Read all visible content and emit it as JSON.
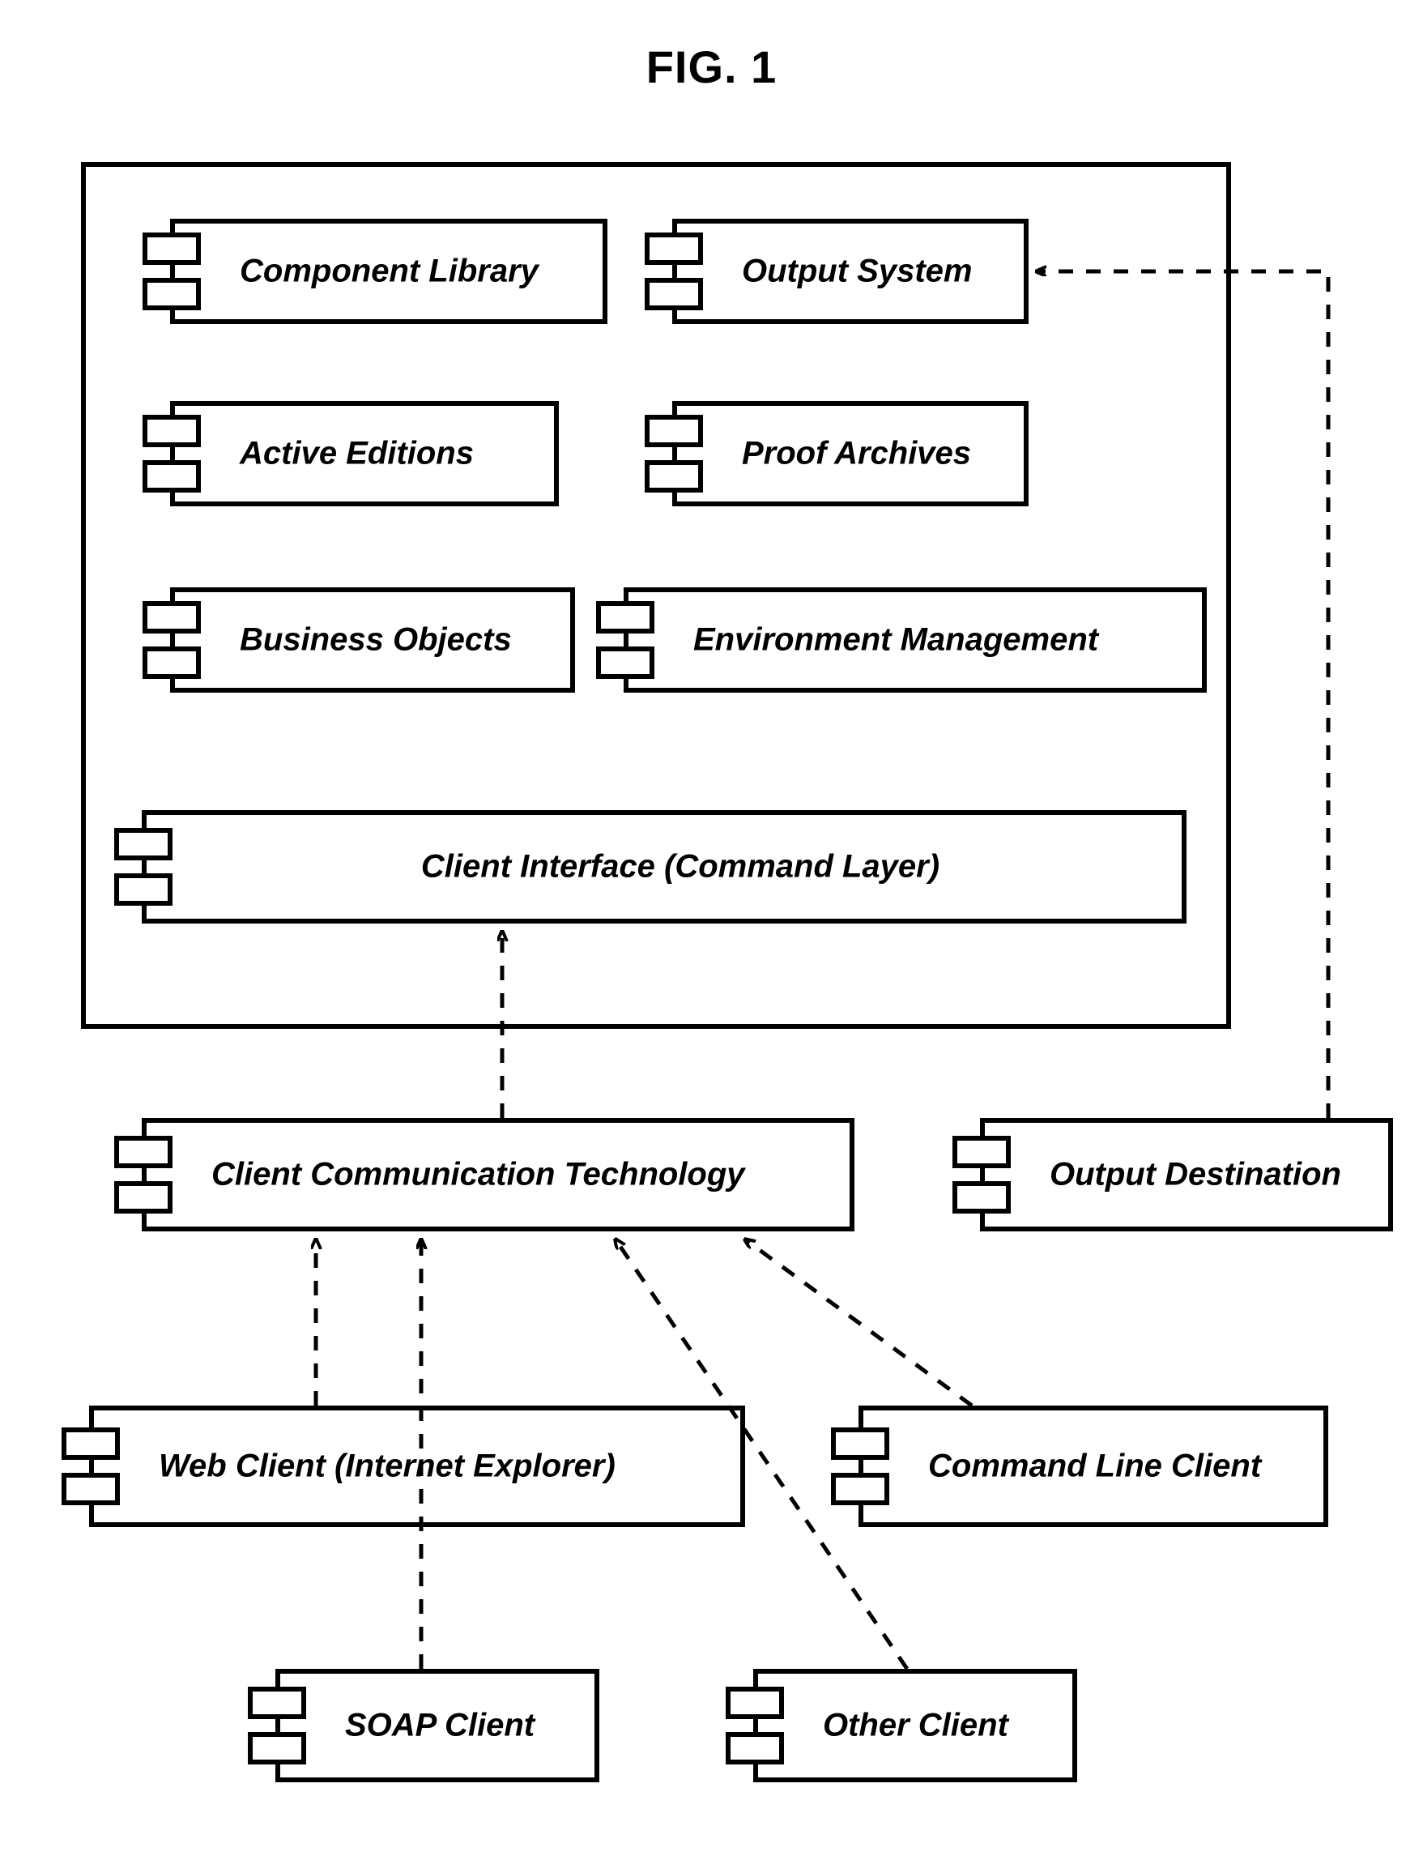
{
  "figure_title": "FIG. 1",
  "container": {
    "components": {
      "component_library": "Component Library",
      "output_system": "Output System",
      "active_editions": "Active Editions",
      "proof_archives": "Proof Archives",
      "business_objects": "Business Objects",
      "environment_management": "Environment Management",
      "client_interface": "Client Interface (Command Layer)"
    }
  },
  "external": {
    "components": {
      "client_comm_tech": "Client Communication Technology",
      "output_destination": "Output Destination",
      "web_client": "Web Client (Internet Explorer)",
      "command_line_client": "Command Line Client",
      "soap_client": "SOAP Client",
      "other_client": "Other Client"
    }
  },
  "relationships": [
    {
      "from": "client_comm_tech",
      "to": "client_interface",
      "style": "dashed-arrow"
    },
    {
      "from": "web_client",
      "to": "client_comm_tech",
      "style": "dashed-arrow"
    },
    {
      "from": "command_line_client",
      "to": "client_comm_tech",
      "style": "dashed-arrow"
    },
    {
      "from": "soap_client",
      "to": "client_comm_tech",
      "style": "dashed-arrow"
    },
    {
      "from": "other_client",
      "to": "client_comm_tech",
      "style": "dashed-arrow"
    },
    {
      "from": "output_destination",
      "to": "output_system",
      "style": "dashed-arrow"
    }
  ]
}
